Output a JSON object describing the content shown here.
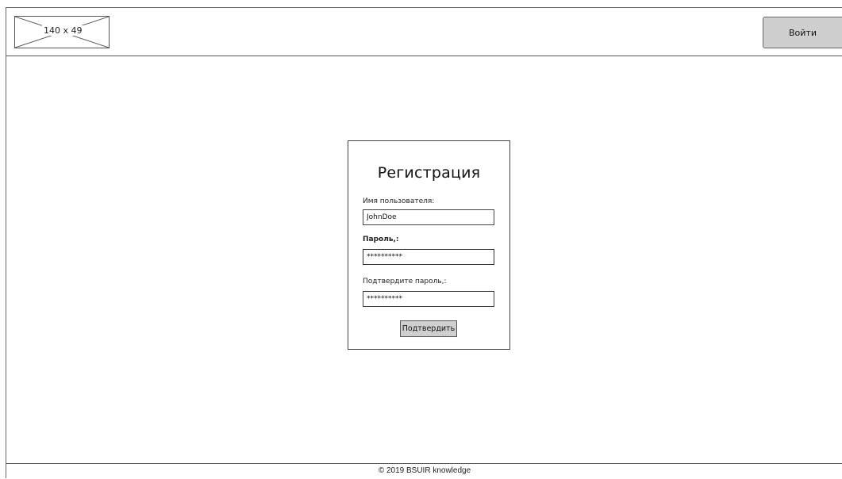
{
  "header": {
    "logo_placeholder_text": "140 x 49",
    "login_button": "Войти"
  },
  "registration": {
    "title": "Регистрация",
    "username": {
      "label": "Имя пользователя:",
      "value": "JohnDoe"
    },
    "password": {
      "label": "Пароль,:",
      "value": "**********"
    },
    "confirm_password": {
      "label": "Подтвердите пароль,:",
      "value": "**********"
    },
    "submit_button": "Подтвердить"
  },
  "footer": {
    "copyright": "© 2019 BSUIR knowledge"
  }
}
